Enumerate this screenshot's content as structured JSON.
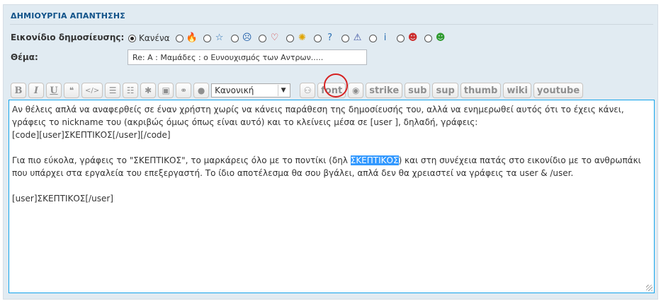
{
  "panel": {
    "title": "ΔΗΜΙΟΥΡΓΙΑ ΑΠΑΝΤΗΣΗΣ"
  },
  "post_icon": {
    "label": "Εικονίδιο δημοσίευσης:",
    "none_label": "Κανένα",
    "icons": [
      {
        "name": "fire-icon",
        "glyph": "🔥",
        "color": "#e67e22"
      },
      {
        "name": "star-icon",
        "glyph": "☆",
        "color": "#2a6fb3"
      },
      {
        "name": "surprised-face-icon",
        "glyph": "☹",
        "color": "#1f5da8"
      },
      {
        "name": "heart-icon",
        "glyph": "♡",
        "color": "#d23a3a"
      },
      {
        "name": "lightbulb-icon",
        "glyph": "✺",
        "color": "#e0a400"
      },
      {
        "name": "question-icon",
        "glyph": "?",
        "color": "#2a6fb3"
      },
      {
        "name": "warning-icon",
        "glyph": "⚠",
        "color": "#3a4fa0"
      },
      {
        "name": "info-icon",
        "glyph": "i",
        "color": "#2a6fb3"
      },
      {
        "name": "angry-face-icon",
        "glyph": "☻",
        "color": "#cc2b2b"
      },
      {
        "name": "grin-face-icon",
        "glyph": "☻",
        "color": "#2f9b2f"
      }
    ]
  },
  "subject": {
    "label": "Θέμα:",
    "value": "Re: A : Μαμάδες : ο Ευνουχισμός των Αντρων....."
  },
  "toolbar": {
    "bold": "B",
    "italic": "I",
    "underline": "U",
    "quote": "❝",
    "code": "</>",
    "list": "☰",
    "list_numbered": "☷",
    "asterisk": "✱",
    "image": "▣",
    "link": "⚭",
    "color": "●",
    "size_select": "Κανονική",
    "user": "⚇",
    "font": "font",
    "hide": "◉",
    "strike": "strike",
    "sub": "sub",
    "sup": "sup",
    "thumb": "thumb",
    "wiki": "wiki",
    "youtube": "youtube"
  },
  "editor": {
    "line1": "Αν θέλεις απλά να αναφερθείς σε έναν χρήστη χωρίς να κάνεις παράθεση της δημοσίευσής του, αλλά να ενημερωθεί αυτός ότι το έχεις κάνει, γράφεις το nickname του (ακριβώς όμως όπως είναι αυτό) και το κλείνεις μέσα σε [user ], δηλαδή, γράφεις:",
    "line2": "[code][user]ΣΚΕΠΤΙΚΟΣ[/user][/code]",
    "line3_before": "Για πιο εύκολα, γράφεις το \"ΣΚΕΠΤΙΚΟΣ\", το μαρκάρεις όλο με το ποντίκι (δηλ ",
    "line3_selected": "ΣΚΕΠΤΙΚΟΣ",
    "line3_after": ") και στη συνέχεια πατάς στο εικονίδιο με το ανθρωπάκι που υπάρχει στα εργαλεία του επεξεργαστή. Το ίδιο αποτέλεσμα θα σου βγάλει, απλά δεν θα χρειαστεί να γράφεις τα user & /user.",
    "line4": "[user]ΣΚΕΠΤΙΚΟΣ[/user]"
  }
}
